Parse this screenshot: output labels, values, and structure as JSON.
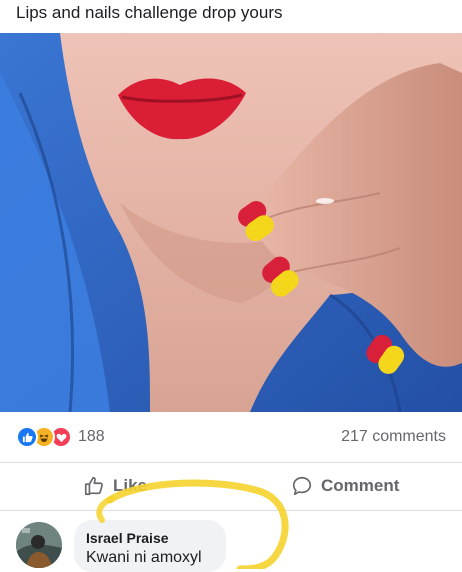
{
  "post": {
    "caption": "Lips and nails challenge drop yours"
  },
  "photo": {
    "icon": "photo-lips-nails"
  },
  "stats": {
    "reactions": [
      "like",
      "haha",
      "love"
    ],
    "reaction_count": "188",
    "comments_count": "217 comments"
  },
  "actions": {
    "like_label": "Like",
    "comment_label": "Comment"
  },
  "comment": {
    "author": "Israel Praise",
    "text": "Kwani ni amoxyl"
  },
  "colors": {
    "like": "#1877f2",
    "haha": "#f7b125",
    "love": "#f33e58",
    "highlight": "#f5d32c",
    "lips": "#d91e36",
    "nail_red": "#d8203a",
    "nail_yellow": "#f4d61a"
  }
}
